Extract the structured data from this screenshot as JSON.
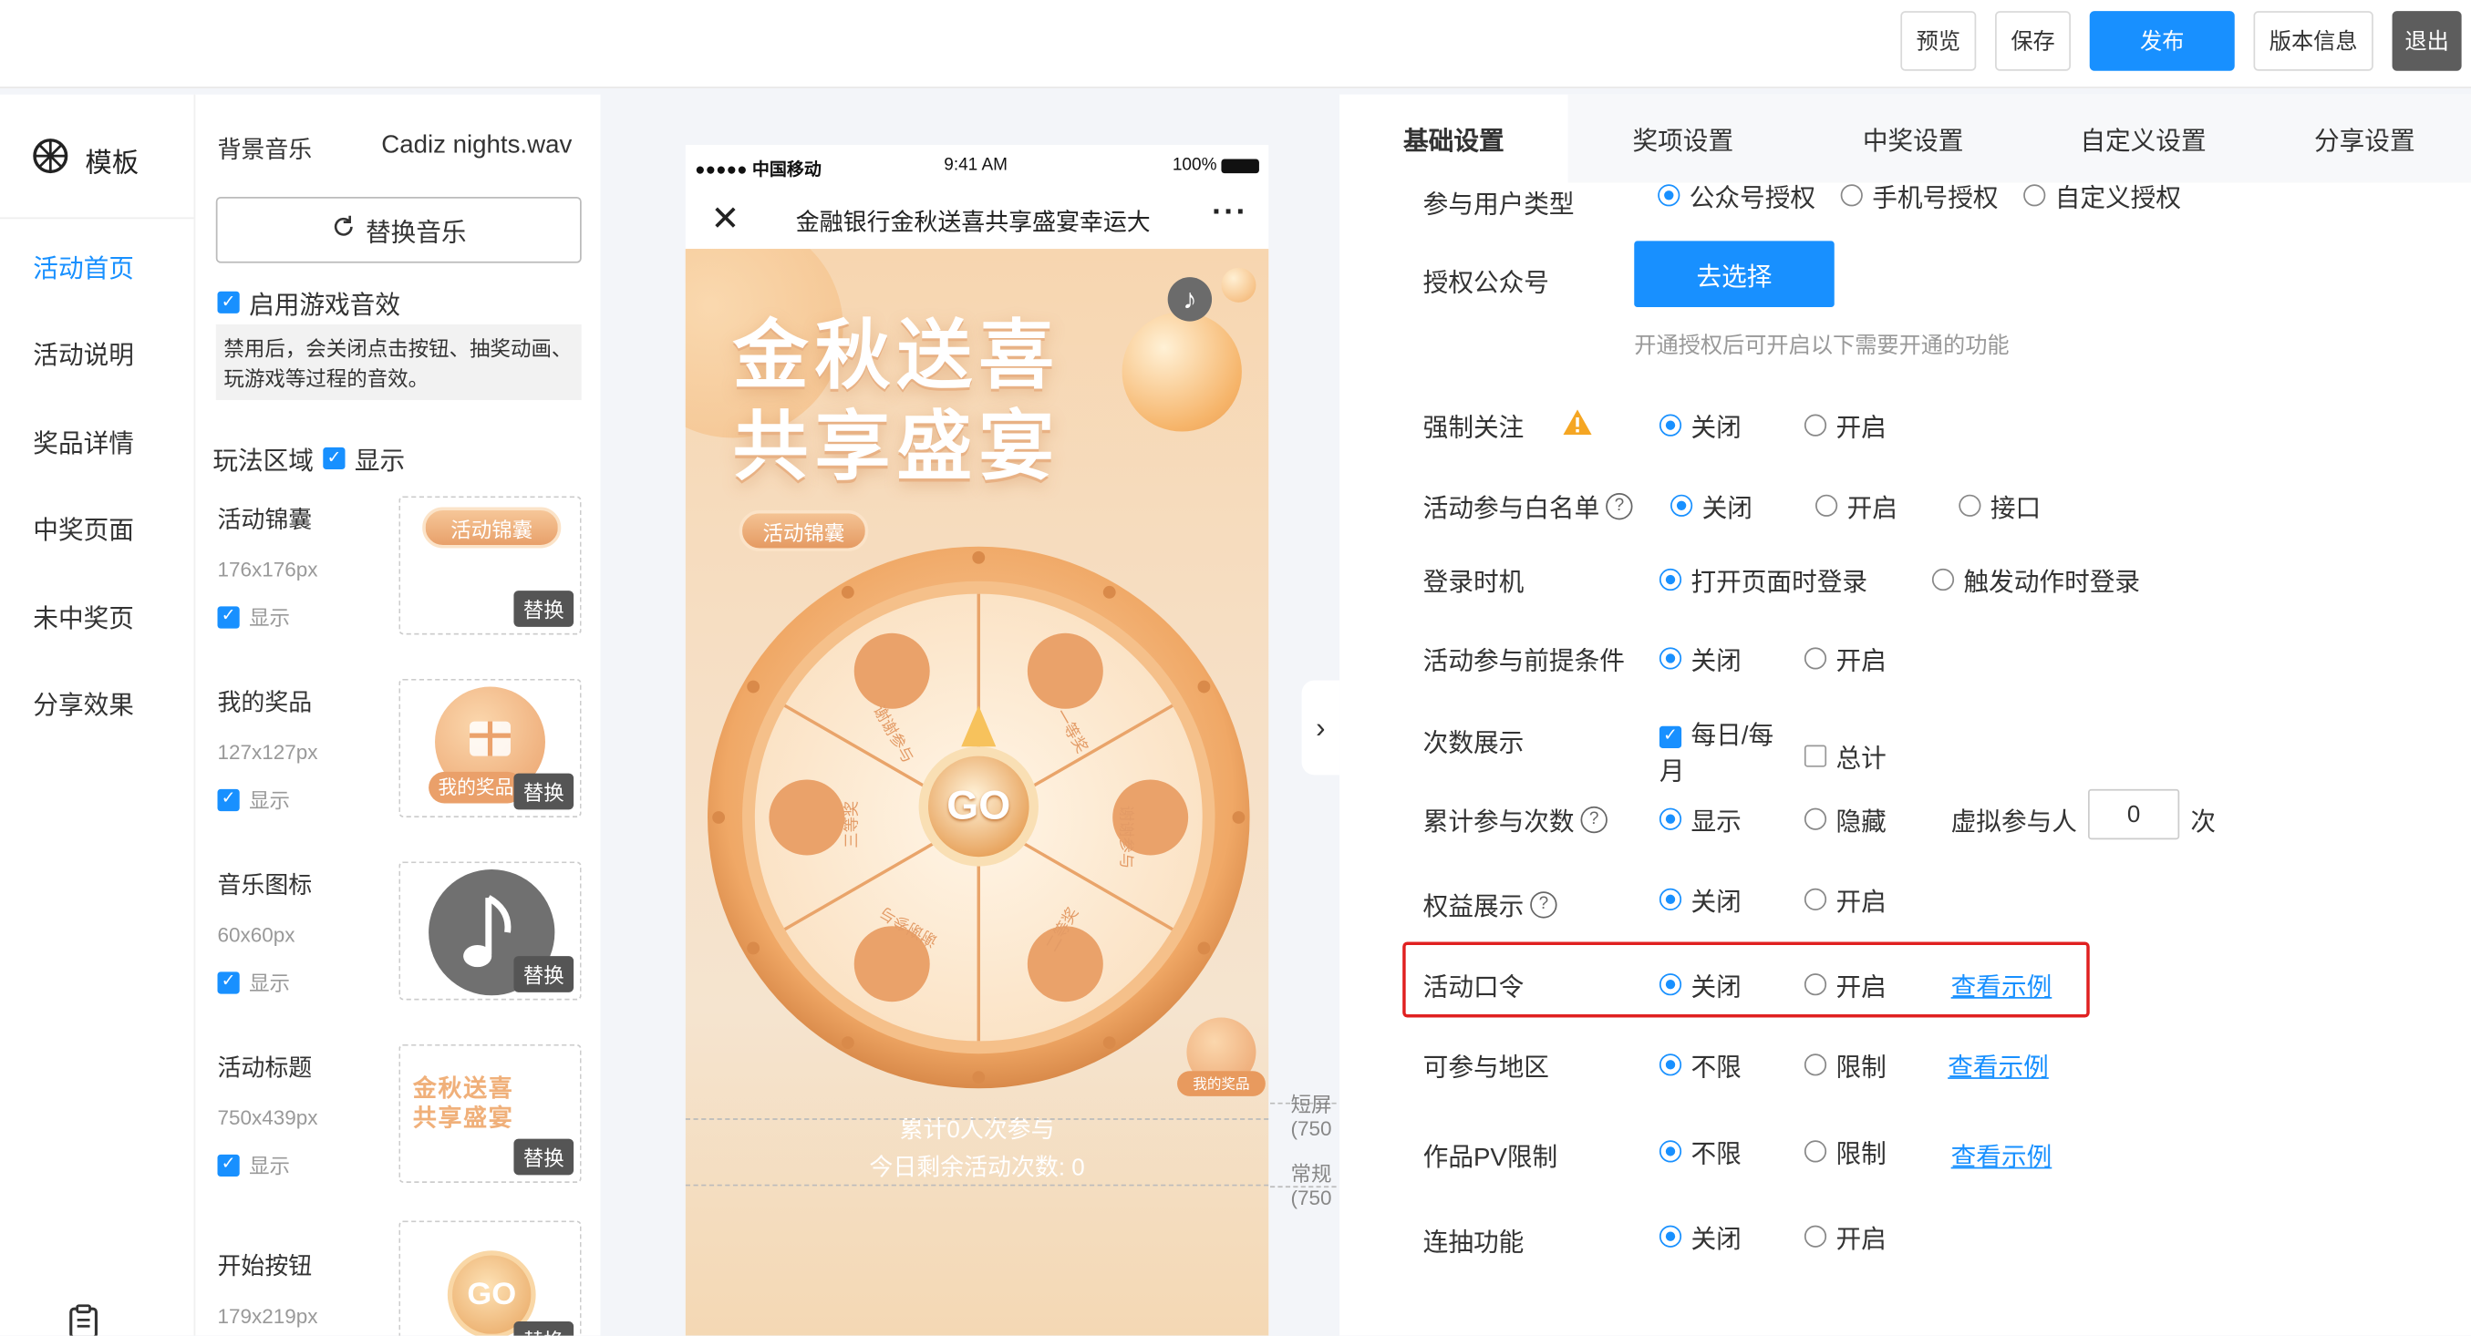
{
  "toolbar": {
    "preview": "预览",
    "save": "保存",
    "publish": "发布",
    "version": "版本信息",
    "exit": "退出"
  },
  "nav": {
    "logo_label": "模板",
    "items": [
      {
        "label": "活动首页",
        "active": true
      },
      {
        "label": "活动说明",
        "active": false
      },
      {
        "label": "奖品详情",
        "active": false
      },
      {
        "label": "中奖页面",
        "active": false
      },
      {
        "label": "未中奖页",
        "active": false
      },
      {
        "label": "分享效果",
        "active": false
      }
    ]
  },
  "assets": {
    "bg_music_label": "背景音乐",
    "bg_music_file": "Cadiz nights.wav",
    "replace_music": "替换音乐",
    "enable_sound": "启用游戏音效",
    "sound_note": "禁用后，会关闭点击按钮、抽奖动画、玩游戏等过程的音效。",
    "play_area_label": "玩法区域",
    "play_area_show": "显示",
    "show_label": "显示",
    "replace_label": "替换",
    "items": [
      {
        "name": "活动锦囊",
        "size": "176x176px",
        "thumb_text": "活动锦囊"
      },
      {
        "name": "我的奖品",
        "size": "127x127px",
        "thumb_text": "我的奖品"
      },
      {
        "name": "音乐图标",
        "size": "60x60px",
        "thumb_text": ""
      },
      {
        "name": "活动标题",
        "size": "750x439px",
        "thumb_text": "金秋送喜 共享盛宴"
      },
      {
        "name": "开始按钮",
        "size": "179x219px",
        "thumb_text": "GO"
      }
    ]
  },
  "phone": {
    "carrier": "●●●●● 中国移动",
    "time": "9:41 AM",
    "battery": "100%",
    "title": "金融银行金秋送喜共享盛宴幸运大",
    "headline_line1": "金秋送喜",
    "headline_line2": "共享盛宴",
    "tips_badge": "活动锦囊",
    "wheel_center": "GO",
    "wheel_prizes": [
      "谢谢参与",
      "一等奖",
      "谢谢参与",
      "二等奖",
      "谢谢参与",
      "三等奖"
    ],
    "my_prize": "我的奖品",
    "total_participants": "累计0人次参与",
    "remaining_today": "今日剩余活动次数: 0",
    "marker_short": "短屏",
    "marker_short_sub": "(750",
    "marker_normal": "常规",
    "marker_normal_sub": "(750"
  },
  "settings": {
    "tabs": [
      {
        "label": "基础设置",
        "active": true
      },
      {
        "label": "奖项设置",
        "active": false
      },
      {
        "label": "中奖设置",
        "active": false
      },
      {
        "label": "自定义设置",
        "active": false
      },
      {
        "label": "分享设置",
        "active": false
      }
    ],
    "user_type": {
      "label": "参与用户类型",
      "options": [
        "公众号授权",
        "手机号授权",
        "自定义授权"
      ]
    },
    "auth_account": {
      "label": "授权公众号",
      "button": "去选择",
      "hint": "开通授权后可开启以下需要开通的功能"
    },
    "force_follow": {
      "label": "强制关注",
      "off": "关闭",
      "on": "开启"
    },
    "whitelist": {
      "label": "活动参与白名单",
      "off": "关闭",
      "on": "开启",
      "api": "接口"
    },
    "login_timing": {
      "label": "登录时机",
      "opt1": "打开页面时登录",
      "opt2": "触发动作时登录"
    },
    "precondition": {
      "label": "活动参与前提条件",
      "off": "关闭",
      "on": "开启"
    },
    "count_display": {
      "label": "次数展示",
      "daily": "每日/每月",
      "daily_line1": "每日/每",
      "daily_line2": "月",
      "total": "总计"
    },
    "cumulative": {
      "label": "累计参与次数",
      "show": "显示",
      "hide": "隐藏",
      "virtual_label": "虚拟参与人",
      "virtual_value": "0",
      "unit": "次"
    },
    "rights": {
      "label": "权益展示",
      "off": "关闭",
      "on": "开启"
    },
    "password": {
      "label": "活动口令",
      "off": "关闭",
      "on": "开启",
      "example": "查看示例"
    },
    "region": {
      "label": "可参与地区",
      "unlimited": "不限",
      "limited": "限制",
      "example": "查看示例"
    },
    "pv_limit": {
      "label": "作品PV限制",
      "unlimited": "不限",
      "limited": "限制",
      "example": "查看示例"
    },
    "multi_draw": {
      "label": "连抽功能",
      "off": "关闭",
      "on": "开启"
    }
  },
  "colors": {
    "accent": "#1890ff",
    "highlight": "#e02020",
    "warning": "#f5a623"
  }
}
